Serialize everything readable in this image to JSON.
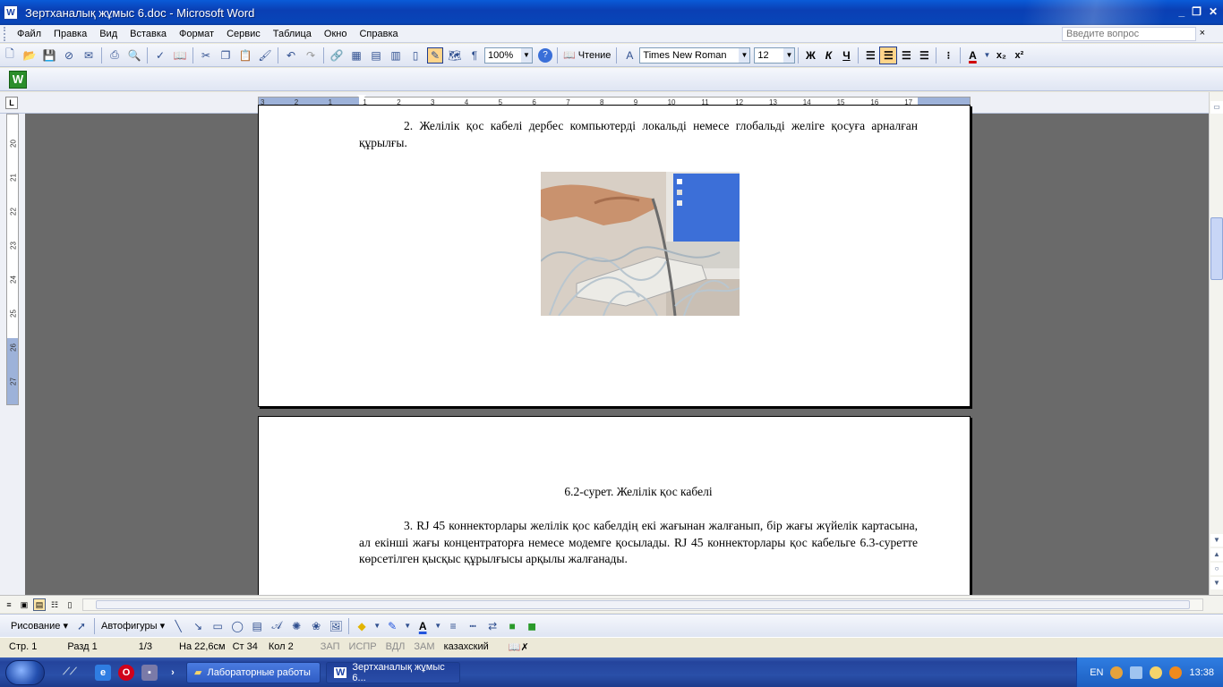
{
  "window": {
    "title": "Зертханалық жұмыс 6.doc - Microsoft Word",
    "app_icon_letter": "W",
    "controls": [
      "_",
      "❐",
      "✕"
    ]
  },
  "menu": {
    "items": [
      "Файл",
      "Правка",
      "Вид",
      "Вставка",
      "Формат",
      "Сервис",
      "Таблица",
      "Окно",
      "Справка"
    ],
    "ask_placeholder": "Введите вопрос",
    "close": "×"
  },
  "toolbar": {
    "zoom": "100%",
    "read_label": "Чтение",
    "font_name": "Times New Roman",
    "font_size": "12",
    "bold": "Ж",
    "italic": "К",
    "underline": "Ч",
    "font_color_label": "A",
    "subscript": "x₂",
    "superscript": "x²",
    "pilcrow": "¶",
    "help": "?"
  },
  "ruler": {
    "tab_selector": "L",
    "h_ticks": [
      "3",
      "2",
      "1",
      "1",
      "2",
      "3",
      "4",
      "5",
      "6",
      "7",
      "8",
      "9",
      "10",
      "11",
      "12",
      "13",
      "14",
      "15",
      "16",
      "17"
    ],
    "v_ticks": [
      "20",
      "21",
      "22",
      "23",
      "24",
      "25",
      "26",
      "27"
    ]
  },
  "document": {
    "page1_paragraph": "2. Желілік қос кабелі дербес компьютерді локальді немесе глобальді желіге қосуға арналған құрылғы.",
    "page2_caption": "6.2-сурет. Желілік қос кабелі",
    "page2_paragraph": "3. RJ 45 коннекторлары желілік қос кабелдің екі жағынан жалғанып, бір жағы жүйелік картасына, ал екінші жағы концентраторға немесе модемге қосылады. RJ 45 коннекторлары қос кабельге 6.3-суретте көрсетілген қысқыс құрылғысы арқылы жалғанады."
  },
  "drawing": {
    "draw_label": "Рисование",
    "autoshapes_label": "Автофигуры"
  },
  "status": {
    "page": "Стр.  1",
    "section": "Разд  1",
    "pages": "1/3",
    "at": "На  22,6см",
    "line": "Ст  34",
    "col": "Кол  2",
    "rec": "ЗАП",
    "trk": "ИСПР",
    "ext": "ВДЛ",
    "ovr": "ЗАМ",
    "lang": "казахский"
  },
  "taskbar": {
    "tasks": [
      "Лабораторные работы",
      "Зертханалық жұмыс 6..."
    ],
    "lang": "EN",
    "clock": "13:38"
  },
  "colors": {
    "titlebar": "#0a3fb4",
    "page_bg": "#6a6a6a",
    "ruler_margin": "#9db2d9"
  }
}
